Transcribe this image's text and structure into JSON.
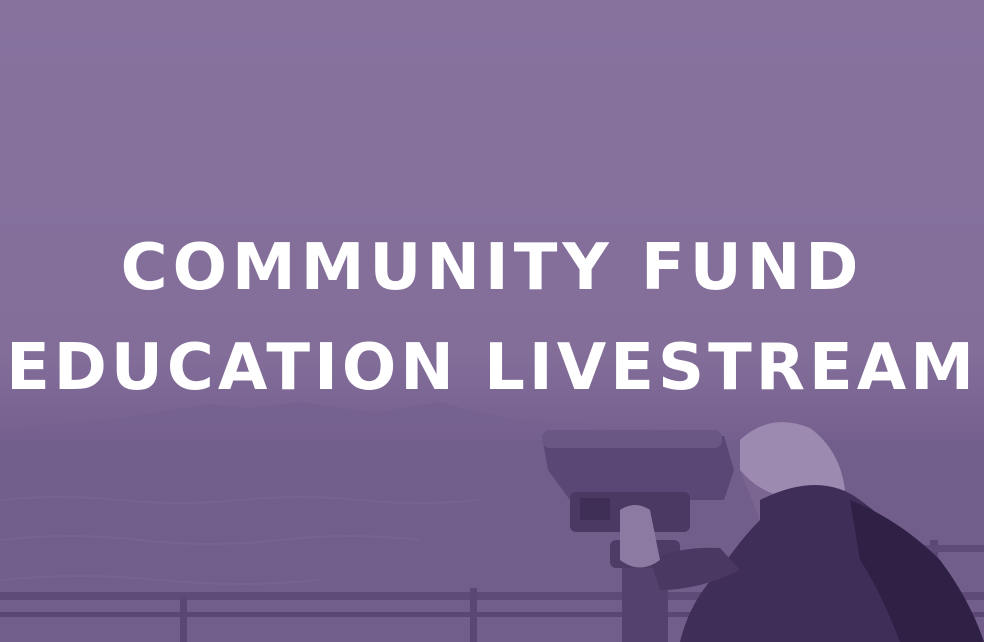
{
  "banner": {
    "title_line_1": "COMMUNITY FUND",
    "title_line_2": "EDUCATION LIVESTREAM"
  },
  "colors": {
    "overlay": "#85709c",
    "text": "#ffffff"
  },
  "background_photo": {
    "subject": "person looking through coin-operated binoculars at the sea",
    "tint": "purple"
  }
}
